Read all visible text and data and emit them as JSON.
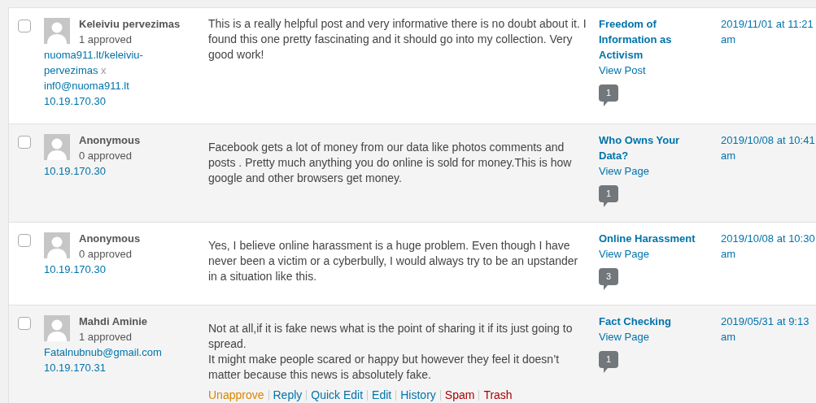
{
  "comments": [
    {
      "selected": false,
      "author": {
        "name": "Keleiviu pervezimas",
        "approved": "1 approved",
        "url": "nuoma911.lt/keleiviu-pervezimas",
        "url_remove": "x",
        "email": "inf0@nuoma911.lt",
        "ip": "10.19.170.30"
      },
      "text": "This is a really helpful post and very informative there is no doubt about it. I found this one pretty fascinating and it should go into my collection. Very good work!",
      "response": {
        "title": "Freedom of Information as Activism",
        "view": "View Post",
        "count": "1"
      },
      "date": "2019/11/01 at 11:21 am"
    },
    {
      "selected": false,
      "author": {
        "name": "Anonymous",
        "approved": "0 approved",
        "ip": "10.19.170.30"
      },
      "text": "Facebook gets a lot of money from our data like photos comments and posts . Pretty much anything you do online is sold for money.This is how google and other browsers get money.",
      "response": {
        "title": "Who Owns Your Data?",
        "view": "View Page",
        "count": "1"
      },
      "date": "2019/10/08 at 10:41 am"
    },
    {
      "selected": false,
      "author": {
        "name": "Anonymous",
        "approved": "0 approved",
        "ip": "10.19.170.30"
      },
      "text": "Yes, I believe online harassment is a huge problem. Even though I have never been a victim or a cyberbully, I would always try to be an upstander in a situation like this.",
      "response": {
        "title": "Online Harassment",
        "view": "View Page",
        "count": "3"
      },
      "date": "2019/10/08 at 10:30 am"
    },
    {
      "selected": false,
      "author": {
        "name": "Mahdi Aminie",
        "approved": "1 approved",
        "email": "Fatalnubnub@gmail.com",
        "ip": "10.19.170.31"
      },
      "paragraphs": [
        "Not at all,if it is fake news what is the point of sharing it if its just going to spread.",
        "It might make people scared or happy but however they feel it doesn’t matter because this news is absolutely fake."
      ],
      "actions": [
        {
          "label": "Unapprove",
          "kind": "unapprove"
        },
        {
          "label": "Reply",
          "kind": "normal"
        },
        {
          "label": "Quick Edit",
          "kind": "normal"
        },
        {
          "label": "Edit",
          "kind": "normal"
        },
        {
          "label": "History",
          "kind": "normal"
        },
        {
          "label": "Spam",
          "kind": "danger"
        },
        {
          "label": "Trash",
          "kind": "danger"
        }
      ],
      "response": {
        "title": "Fact Checking",
        "view": "View Page",
        "count": "1"
      },
      "date": "2019/05/31 at 9:13 am"
    }
  ]
}
